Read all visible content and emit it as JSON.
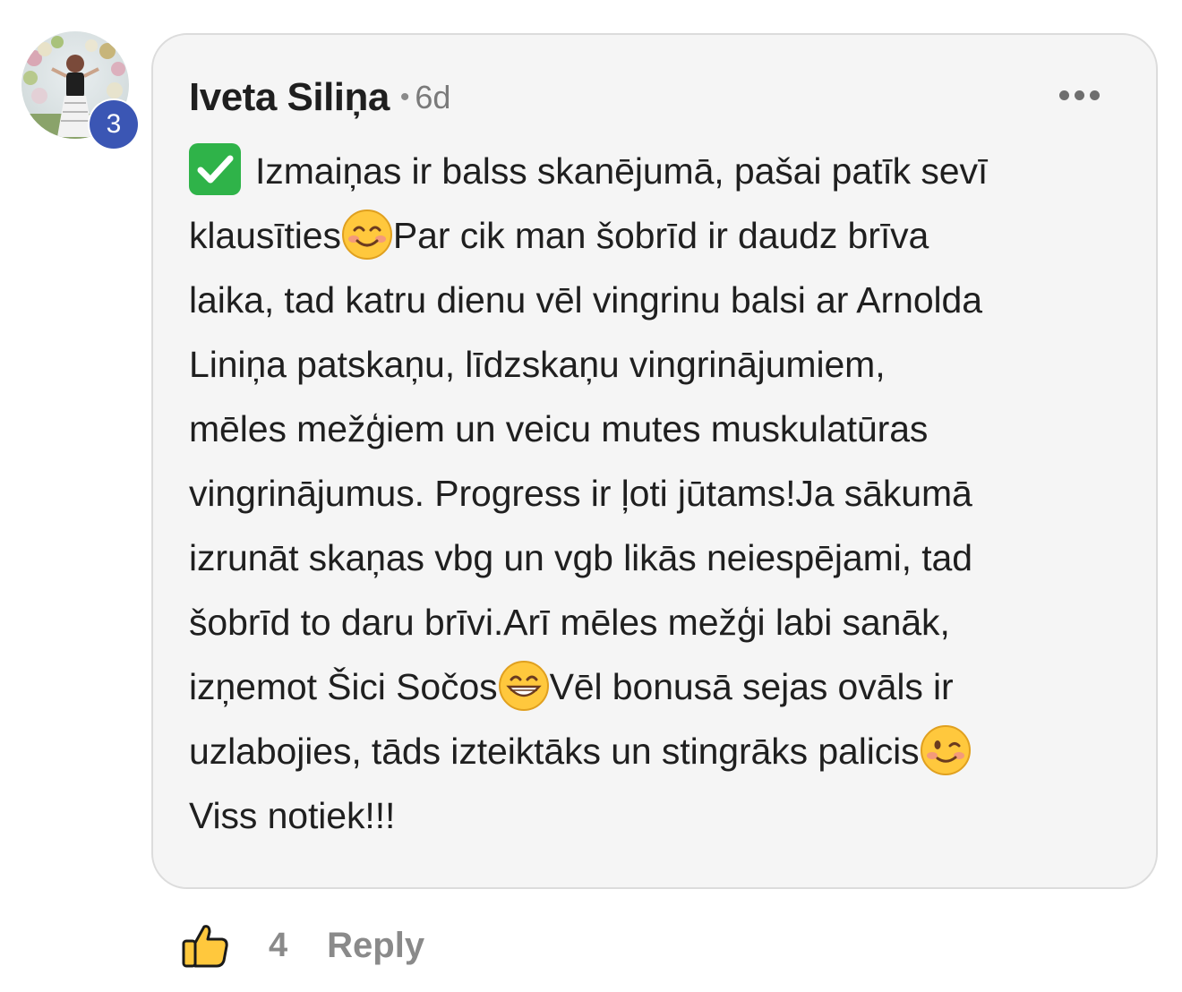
{
  "comment": {
    "author": "Iveta Siliņa",
    "time_separator": "•",
    "time": "6d",
    "avatar_badge": "3",
    "lines": [
      "Izmaiņas ir balss skanējumā, pašai patīk sevī",
      "klausīties",
      "Par cik man šobrīd ir daudz brīva",
      "laika, tad katru dienu vēl vingrinu balsi ar Arnolda",
      "Liniņa patskaņu, līdzskaņu vingrinājumiem,",
      "mēles mežģiem un veicu mutes muskulatūras",
      "vingrinājumus. Progress ir ļoti jūtams!Ja sākumā",
      "izrunāt skaņas vbg un vgb likās neiespējami, tad",
      "šobrīd to daru brīvi.Arī mēles mežģi labi sanāk,",
      "izņemot Šici Sočos",
      "Vēl bonusā sejas ovāls ir",
      "uzlabojies, tāds izteiktāks un stingrāks palicis",
      "Viss notiek!!!"
    ],
    "emojis": [
      "check-mark-emoji",
      "smiling-face-emoji",
      "grinning-face-emoji",
      "winking-face-emoji"
    ]
  },
  "footer": {
    "like_count": "4",
    "reply_label": "Reply"
  },
  "colors": {
    "badge": "#3b56b4",
    "bubble_bg": "#f5f5f5",
    "check_green": "#2fb349",
    "muted_text": "#8a8a8a"
  }
}
